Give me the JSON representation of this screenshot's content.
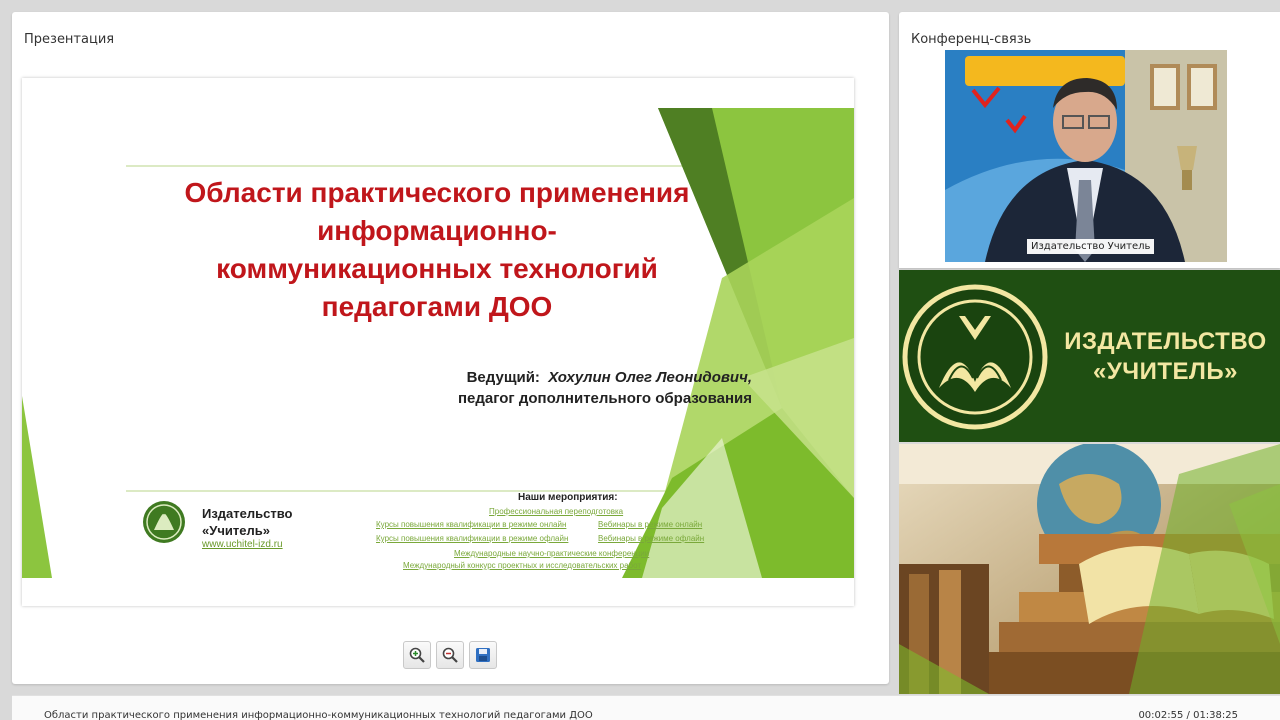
{
  "panels": {
    "presentation_title": "Презентация",
    "conference_title": "Конференц-связь"
  },
  "slide": {
    "title": "Области практического применения информационно-коммуникационных технологий педагогами ДОО",
    "title_lines": [
      "Области практического применения",
      "информационно-",
      "коммуникационных технологий",
      "педагогами ДОО"
    ],
    "presenter_label": "Ведущий:",
    "presenter_name": "Хохулин Олег Леонидович,",
    "presenter_role": "педагог дополнительного образования",
    "publisher_line1": "Издательство",
    "publisher_line2": "«Учитель»",
    "publisher_url": "www.uchitel-izd.ru",
    "events_heading": "Наши мероприятия:",
    "events": [
      "Профессиональная переподготовка",
      "Курсы повышения квалификации в режиме онлайн",
      "Вебинары в режиме онлайн",
      "Курсы повышения квалификации в режиме офлайн",
      "Вебинары в режиме офлайн",
      "Международные научно-практические конференции",
      "Международный конкурс проектных и исследовательских работ"
    ]
  },
  "toolbar": {
    "zoom_in_icon": "zoom-in-icon",
    "zoom_out_icon": "zoom-out-icon",
    "save_icon": "floppy-disk-icon"
  },
  "conference": {
    "video_label": "Издательство Учитель"
  },
  "banner": {
    "line1": "ИЗДАТЕЛЬСТВО",
    "line2": "«УЧИТЕЛЬ»"
  },
  "status": {
    "title": "Области практического применения информационно-коммуникационных технологий педагогами ДОО",
    "time": "00:02:55 / 01:38:25"
  },
  "colors": {
    "title_red": "#c0161b",
    "slide_green": "#7dbb2c",
    "banner_green": "#1f4f12",
    "banner_gold": "#f3e7a2"
  }
}
